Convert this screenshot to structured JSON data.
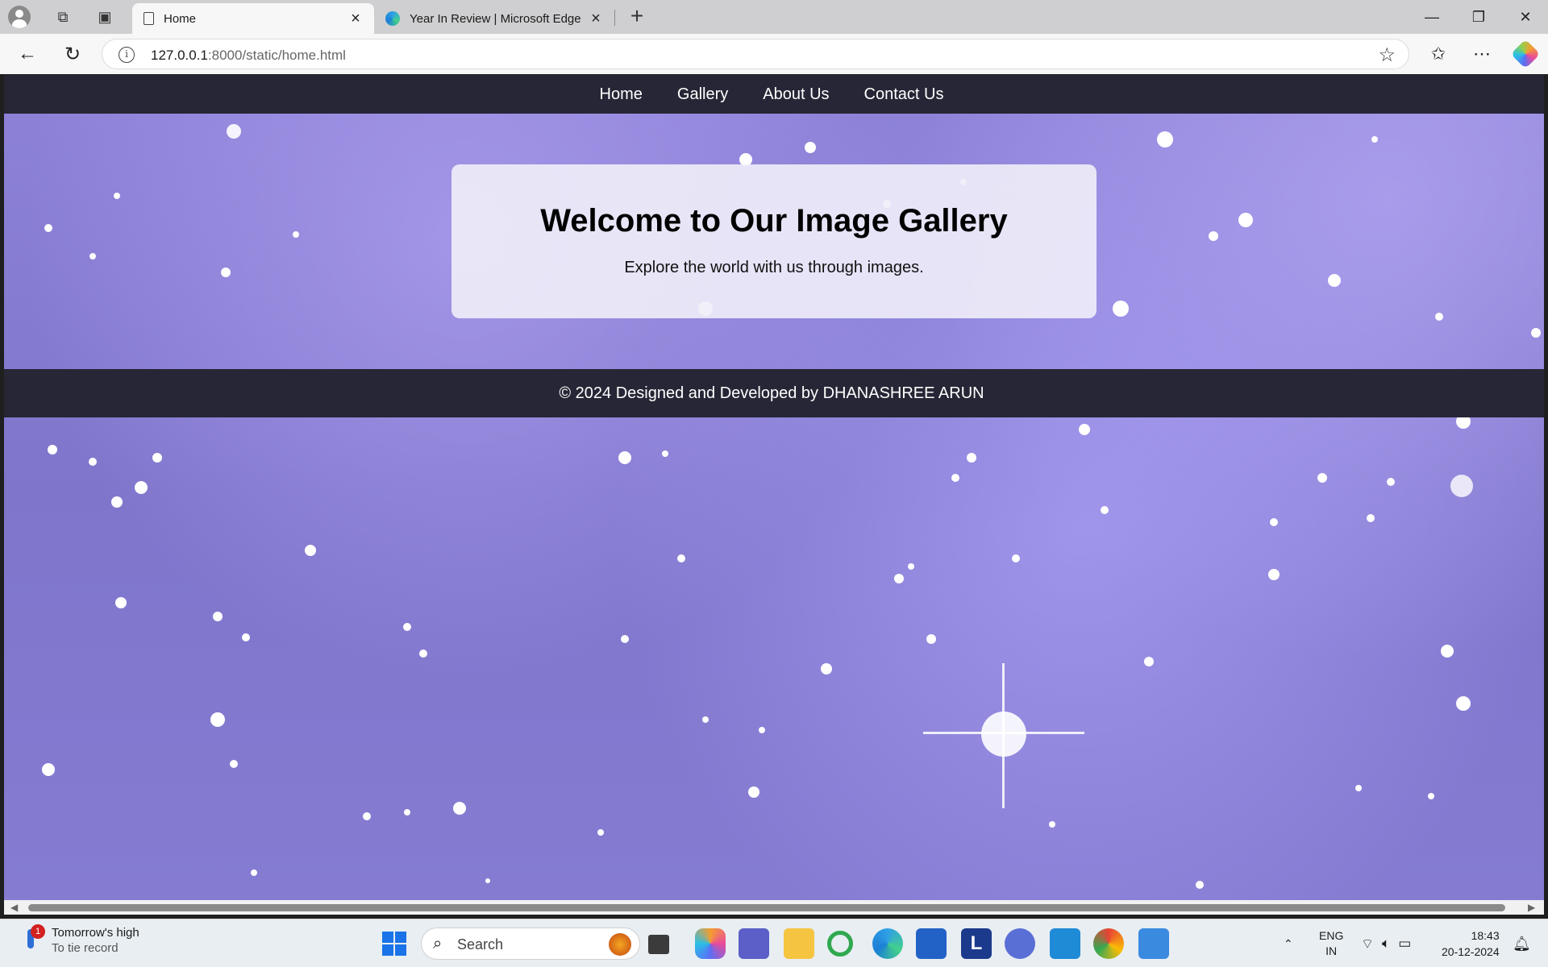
{
  "browser": {
    "tabs": [
      {
        "title": "Home",
        "active": true
      },
      {
        "title": "Year In Review | Microsoft Edge",
        "active": false
      }
    ],
    "url_host": "127.0.0.1",
    "url_rest": ":8000/static/home.html"
  },
  "site": {
    "nav": [
      "Home",
      "Gallery",
      "About Us",
      "Contact Us"
    ],
    "hero_title": "Welcome to Our Image Gallery",
    "hero_subtitle": "Explore the world with us through images.",
    "footer": "© 2024 Designed and Developed by DHANASHREE ARUN"
  },
  "taskbar": {
    "weather_title": "Tomorrow's high",
    "weather_sub": "To tie record",
    "weather_badge": "1",
    "search_label": "Search",
    "lang_top": "ENG",
    "lang_bottom": "IN",
    "time": "18:43",
    "date": "20-12-2024",
    "apps": [
      "task-view",
      "copilot",
      "teams",
      "file-explorer",
      "refresh-app",
      "edge",
      "store",
      "l-app",
      "app-a",
      "vscode",
      "chrome",
      "notepad"
    ]
  },
  "colors": {
    "nav_bg": "#262636",
    "page_bg": "#8d82d8"
  }
}
